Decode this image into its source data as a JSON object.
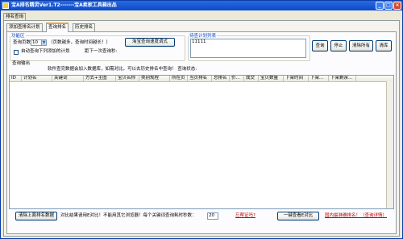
{
  "window": {
    "title": "宝A排名精灵Ver1.T2-------宝A卖家工具箱出品"
  },
  "group_tab": "排名查询",
  "tabs": [
    {
      "label": "添加查排名计划"
    },
    {
      "label": "查询排名"
    },
    {
      "label": "历史排名"
    }
  ],
  "function_area": {
    "legend": "功能区",
    "pages_label": "查询页数",
    "pages_value": "10",
    "pages_hint": "（页数越多，查询时间越长！）",
    "mode_button": "淘宝查询速度调式",
    "auto_label": "自动查询下列添加的计划",
    "next_label": "距下一次查询秒:"
  },
  "plan_list": {
    "legend": "待查计划列表",
    "value": "11111"
  },
  "action_buttons": {
    "query": "查询",
    "stop": "停止",
    "clear_all": "清除所有",
    "clear": "清库"
  },
  "output": {
    "label": "查询输出",
    "message": "软件查完数据会加入数据库，如需对比，可以去历史排名中查询！ 查询状态:"
  },
  "table": {
    "columns": [
      "ID",
      "计划名",
      "关键词",
      "方式+主图",
      "宝贝名称",
      "类别规程",
      "所在页",
      "当页排名",
      "总排名",
      "价...",
      "成交",
      "宝贝数量",
      "下架时间",
      "下架...",
      "下架剩余..."
    ]
  },
  "bottom": {
    "clear_db": "清除上面排名数据",
    "compare_prefix": "对比结果请用E对比！不能用其它浏览器！每个关键词查询耗时秒数：",
    "seconds": "20",
    "forgot_link": "忘帮证吗?",
    "view_compare": "一键查看E对比",
    "latest_link": "国内最准确排名！（查询详情）"
  }
}
